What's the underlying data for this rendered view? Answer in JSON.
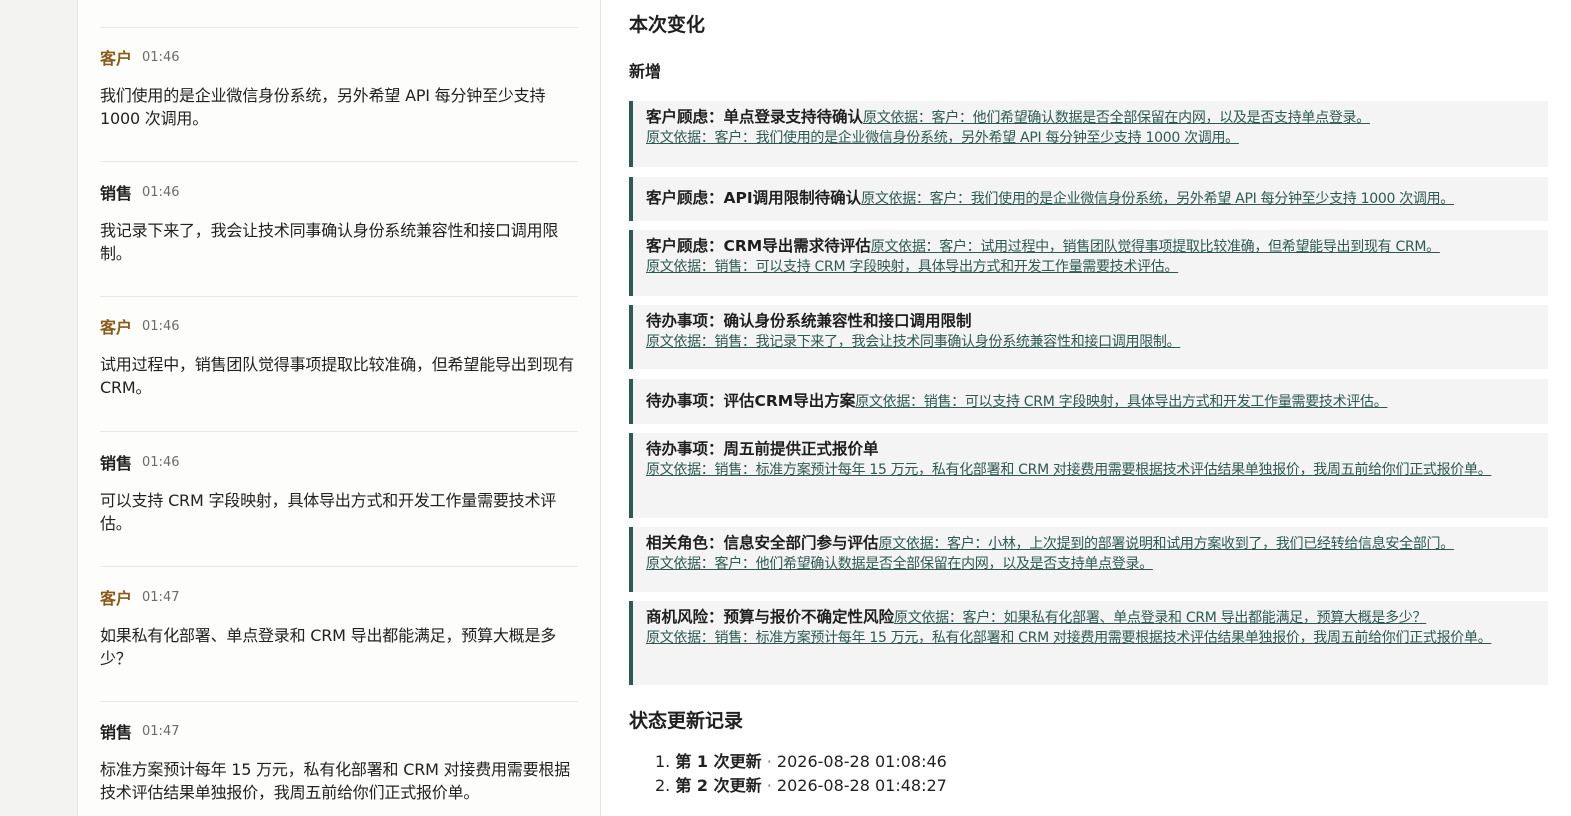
{
  "chat": {
    "messages": [
      {
        "role": "客户",
        "time": "01:46",
        "text": "我们使用的是企业微信身份系统，另外希望 API 每分钟至少支持 1000 次调用。"
      },
      {
        "role": "销售",
        "time": "01:46",
        "text": "我记录下来了，我会让技术同事确认身份系统兼容性和接口调用限制。"
      },
      {
        "role": "客户",
        "time": "01:46",
        "text": "试用过程中，销售团队觉得事项提取比较准确，但希望能导出到现有 CRM。"
      },
      {
        "role": "销售",
        "time": "01:46",
        "text": "可以支持 CRM 字段映射，具体导出方式和开发工作量需要技术评估。"
      },
      {
        "role": "客户",
        "time": "01:47",
        "text": "如果私有化部署、单点登录和 CRM 导出都能满足，预算大概是多少？"
      },
      {
        "role": "销售",
        "time": "01:47",
        "text": "标准方案预计每年 15 万元，私有化部署和 CRM 对接费用需要根据技术评估结果单独报价，我周五前给你们正式报价单。"
      }
    ]
  },
  "changes": {
    "title": "本次变化",
    "subtitle": "新增",
    "items": [
      {
        "title": "客户顾虑：单点登录支持待确认",
        "evidence": [
          "原文依据：客户：他们希望确认数据是否全部保留在内网，以及是否支持单点登录。",
          "原文依据：客户：我们使用的是企业微信身份系统，另外希望 API 每分钟至少支持 1000 次调用。"
        ]
      },
      {
        "title": "客户顾虑：API调用限制待确认",
        "evidence": [
          "原文依据：客户：我们使用的是企业微信身份系统，另外希望 API 每分钟至少支持 1000 次调用。"
        ]
      },
      {
        "title": "客户顾虑：CRM导出需求待评估",
        "evidence": [
          "原文依据：客户：试用过程中，销售团队觉得事项提取比较准确，但希望能导出到现有 CRM。",
          "原文依据：销售：可以支持 CRM 字段映射，具体导出方式和开发工作量需要技术评估。"
        ]
      },
      {
        "title": "待办事项：确认身份系统兼容性和接口调用限制",
        "evidence": [
          "原文依据：销售：我记录下来了，我会让技术同事确认身份系统兼容性和接口调用限制。"
        ]
      },
      {
        "title": "待办事项：评估CRM导出方案",
        "evidence": [
          "原文依据：销售：可以支持 CRM 字段映射，具体导出方式和开发工作量需要技术评估。"
        ]
      },
      {
        "title": "待办事项：周五前提供正式报价单",
        "evidence": [
          "原文依据：销售：标准方案预计每年 15 万元，私有化部署和 CRM 对接费用需要根据技术评估结果单独报价，我周五前给你们正式报价单。"
        ]
      },
      {
        "title": "相关角色：信息安全部门参与评估",
        "evidence": [
          "原文依据：客户：小林，上次提到的部署说明和试用方案收到了，我们已经转给信息安全部门。",
          "原文依据：客户：他们希望确认数据是否全部保留在内网，以及是否支持单点登录。"
        ]
      },
      {
        "title": "商机风险：预算与报价不确定性风险",
        "evidence": [
          "原文依据：客户：如果私有化部署、单点登录和 CRM 导出都能满足，预算大概是多少？",
          "原文依据：销售：标准方案预计每年 15 万元，私有化部署和 CRM 对接费用需要根据技术评估结果单独报价，我周五前给你们正式报价单。"
        ]
      }
    ]
  },
  "log": {
    "title": "状态更新记录",
    "items": [
      {
        "index": "1.",
        "label": "第 1 次更新",
        "sep": "·",
        "time": "2026-08-28 01:08:46"
      },
      {
        "index": "2.",
        "label": "第 2 次更新",
        "sep": "·",
        "time": "2026-08-28 01:48:27"
      }
    ]
  },
  "colors": {
    "accent": "#2f5a53",
    "customer_role": "#8a5a1a"
  }
}
